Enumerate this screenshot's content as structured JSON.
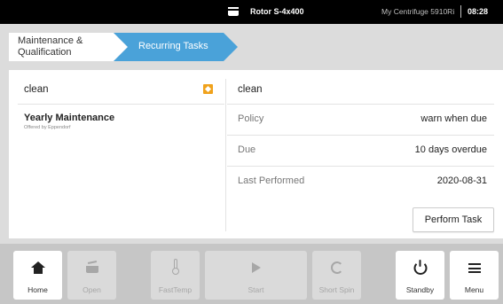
{
  "status_bar": {
    "rotor": "Rotor S-4x400",
    "device": "My Centrifuge 5910Ri",
    "time": "08:28"
  },
  "breadcrumb": {
    "items": [
      {
        "label": "Maintenance & Qualification"
      },
      {
        "label": "Recurring Tasks"
      }
    ]
  },
  "left_panel": {
    "task_name": "clean",
    "items": [
      {
        "title": "Yearly Maintenance",
        "subtitle": "Offered by Eppendorf"
      }
    ]
  },
  "right_panel": {
    "title": "clean",
    "rows": [
      {
        "label": "Policy",
        "value": "warn when due"
      },
      {
        "label": "Due",
        "value": "10 days overdue"
      },
      {
        "label": "Last Performed",
        "value": "2020-08-31"
      }
    ],
    "action_button": "Perform Task"
  },
  "bottom_bar": {
    "buttons": [
      {
        "label": "Home",
        "icon": "home-icon",
        "enabled": true
      },
      {
        "label": "Open",
        "icon": "lid-open-icon",
        "enabled": false
      },
      {
        "label": "FastTemp",
        "icon": "thermometer-icon",
        "enabled": false
      },
      {
        "label": "Start",
        "icon": "play-icon",
        "enabled": false
      },
      {
        "label": "Short Spin",
        "icon": "short-spin-icon",
        "enabled": false
      },
      {
        "label": "Standby",
        "icon": "power-icon",
        "enabled": true
      },
      {
        "label": "Menu",
        "icon": "menu-icon",
        "enabled": true
      }
    ]
  },
  "colors": {
    "accent": "#4aa2d9",
    "badge": "#f0a21c",
    "status_bar_bg": "#000000",
    "bottom_bar_bg": "#c6c6c6"
  }
}
